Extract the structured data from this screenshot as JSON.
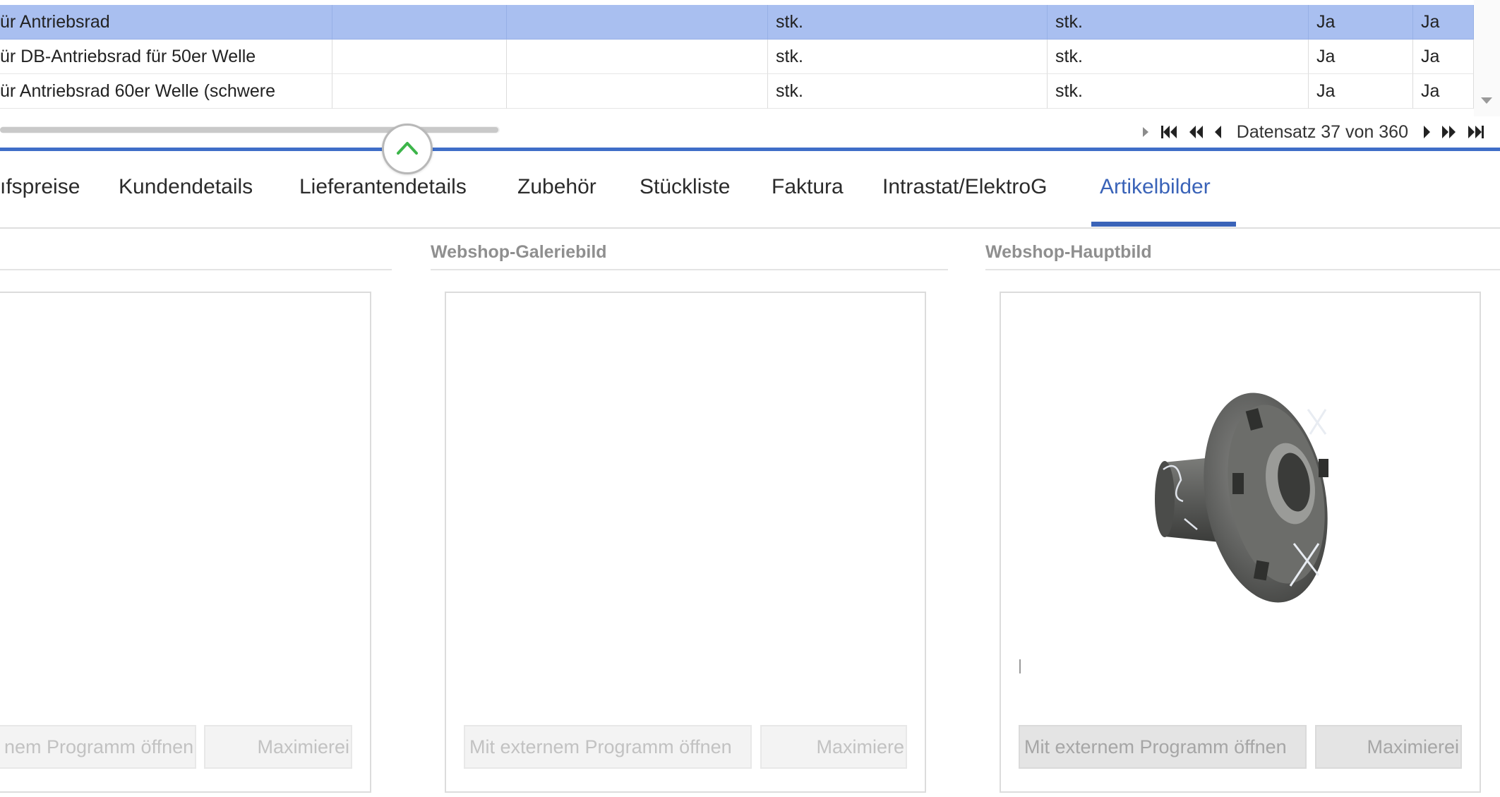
{
  "grid": {
    "rows": [
      {
        "c1": "ür Antriebsrad",
        "c2": "",
        "c3": "",
        "c4": "stk.",
        "c5": "stk.",
        "c6": "Ja",
        "c7": "Ja"
      },
      {
        "c1": "ür DB-Antriebsrad für 50er Welle",
        "c2": "",
        "c3": "",
        "c4": "stk.",
        "c5": "stk.",
        "c6": "Ja",
        "c7": "Ja"
      },
      {
        "c1": "ür Antriebsrad 60er Welle (schwere",
        "c2": "",
        "c3": "",
        "c4": "stk.",
        "c5": "stk.",
        "c6": "Ja",
        "c7": "Ja"
      }
    ],
    "selected_row": 0
  },
  "pager": {
    "status": "Datensatz 37 von 360"
  },
  "tabs": [
    {
      "label": "ıfspreise",
      "active": false
    },
    {
      "label": "Kundendetails",
      "active": false
    },
    {
      "label": "Lieferantendetails",
      "active": false
    },
    {
      "label": "Zubehör",
      "active": false
    },
    {
      "label": "Stückliste",
      "active": false
    },
    {
      "label": "Faktura",
      "active": false
    },
    {
      "label": "Intrastat/ElektroG",
      "active": false
    },
    {
      "label": "Artikelbilder",
      "active": true
    }
  ],
  "panels": [
    {
      "title": "",
      "open_label": "nem Programm öffnen",
      "max_label": "Maximierei",
      "has_image": false
    },
    {
      "title": "Webshop-Galeriebild",
      "open_label": "Mit externem Programm öffnen",
      "max_label": "Maximiere",
      "has_image": false
    },
    {
      "title": "Webshop-Hauptbild",
      "open_label": "Mit externem Programm öffnen",
      "max_label": "Maximierei",
      "has_image": true
    }
  ],
  "colors": {
    "selection": "#a9bff0",
    "accent": "#3a63b8",
    "splitter": "#3f6ec8",
    "collapse_icon": "#3db54a"
  },
  "icons": {
    "collapse": "chevron-up-icon",
    "pager_first": "first-record-icon",
    "pager_prev_page": "previous-page-icon",
    "pager_prev": "previous-record-icon",
    "pager_next": "next-record-icon",
    "pager_next_page": "next-page-icon",
    "pager_last": "last-record-icon"
  }
}
